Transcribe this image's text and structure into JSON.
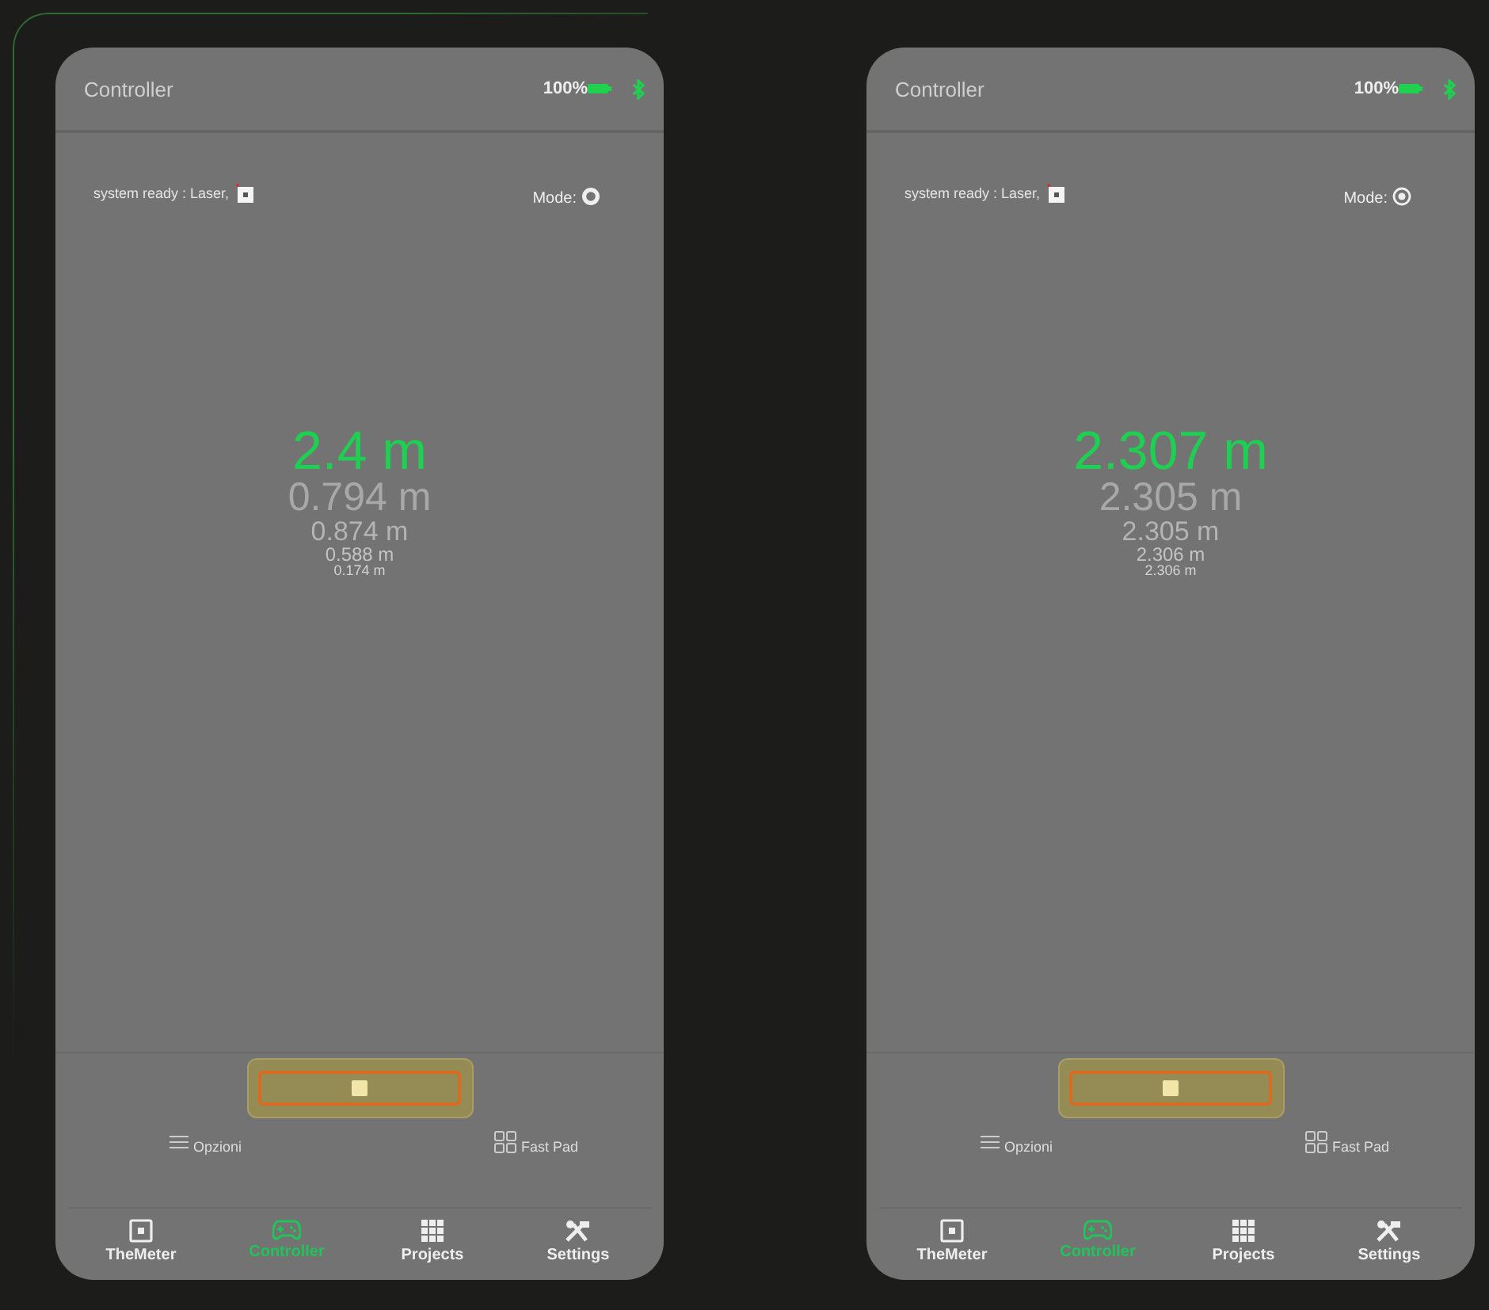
{
  "phones": [
    {
      "title": "Controller",
      "battery": "100%",
      "status": "system ready : Laser,",
      "mode": {
        "label": "Mode:",
        "kind": "ring"
      },
      "readings": [
        "2.4 m",
        "0.794 m",
        "0.874 m",
        "0.588 m",
        "0.174 m"
      ],
      "options": [
        "Opzioni",
        "Fast Pad"
      ],
      "nav": [
        {
          "label": "TheMeter",
          "selected": false
        },
        {
          "label": "Controller",
          "selected": true
        },
        {
          "label": "Projects",
          "selected": false
        },
        {
          "label": "Settings",
          "selected": false
        }
      ]
    },
    {
      "title": "Controller",
      "battery": "100%",
      "status": "system ready : Laser,",
      "mode": {
        "label": "Mode:",
        "kind": "target"
      },
      "readings": [
        "2.307 m",
        "2.305 m",
        "2.305 m",
        "2.306 m",
        "2.306 m"
      ],
      "options": [
        "Opzioni",
        "Fast Pad"
      ],
      "nav": [
        {
          "label": "TheMeter",
          "selected": false
        },
        {
          "label": "Controller",
          "selected": true
        },
        {
          "label": "Projects",
          "selected": false
        },
        {
          "label": "Settings",
          "selected": false
        }
      ]
    }
  ]
}
